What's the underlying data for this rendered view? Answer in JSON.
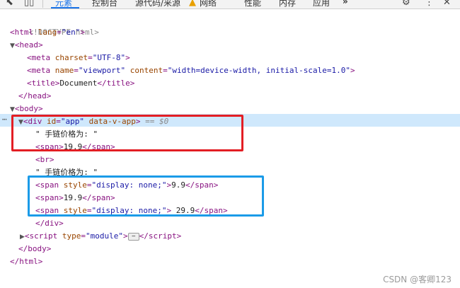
{
  "toolbar": {
    "tabs": [
      {
        "label": "元素",
        "active": true
      },
      {
        "label": "控制台",
        "active": false
      },
      {
        "label": "源代码/来源",
        "active": false
      },
      {
        "label": "网络",
        "active": false
      },
      {
        "label": "性能",
        "active": false
      },
      {
        "label": "内存",
        "active": false
      },
      {
        "label": "应用",
        "active": false
      }
    ],
    "more": "»",
    "inspect_icon": "cursor-select-icon",
    "device_icon": "device-toggle-icon",
    "warning_icon": "warning-icon",
    "settings_icon": "gear-icon",
    "menu_icon": "kebab-menu-icon",
    "close_icon": "close-icon"
  },
  "dom": {
    "doctype": "<!DOCTYPE html>",
    "html_open_tag": "html",
    "html_lang_attr": "lang",
    "html_lang_value": "\"en\"",
    "head_tag": "head",
    "meta1_attr": "charset",
    "meta1_value": "\"UTF-8\"",
    "meta2_attr1": "name",
    "meta2_value1": "\"viewport\"",
    "meta2_attr2": "content",
    "meta2_value2": "\"width=device-width, initial-scale=1.0\"",
    "title_text": "Document",
    "body_tag": "body",
    "div_id_attr": "id",
    "div_id_value": "\"app\"",
    "div_data_attr": "data-v-app",
    "selected_marker": "== $0",
    "text_label_1": "\" 手链价格为: \"",
    "span_price_1": "19.9",
    "br_tag": "br",
    "text_label_2": "\" 手链价格为: \"",
    "span_style_attr": "style",
    "span_style_value": "\"display: none;\"",
    "span_hidden_1_text": "9.9",
    "span_visible_text": "19.9",
    "span_hidden_2_text": " 29.9",
    "script_type_attr": "type",
    "script_type_value": "\"module\"",
    "ellipsis": "⋯",
    "row_menu": "⋯"
  },
  "annotations": {
    "red_box_color": "#e31e24",
    "blue_box_color": "#1b9be8"
  },
  "watermark": "CSDN @客卿123"
}
